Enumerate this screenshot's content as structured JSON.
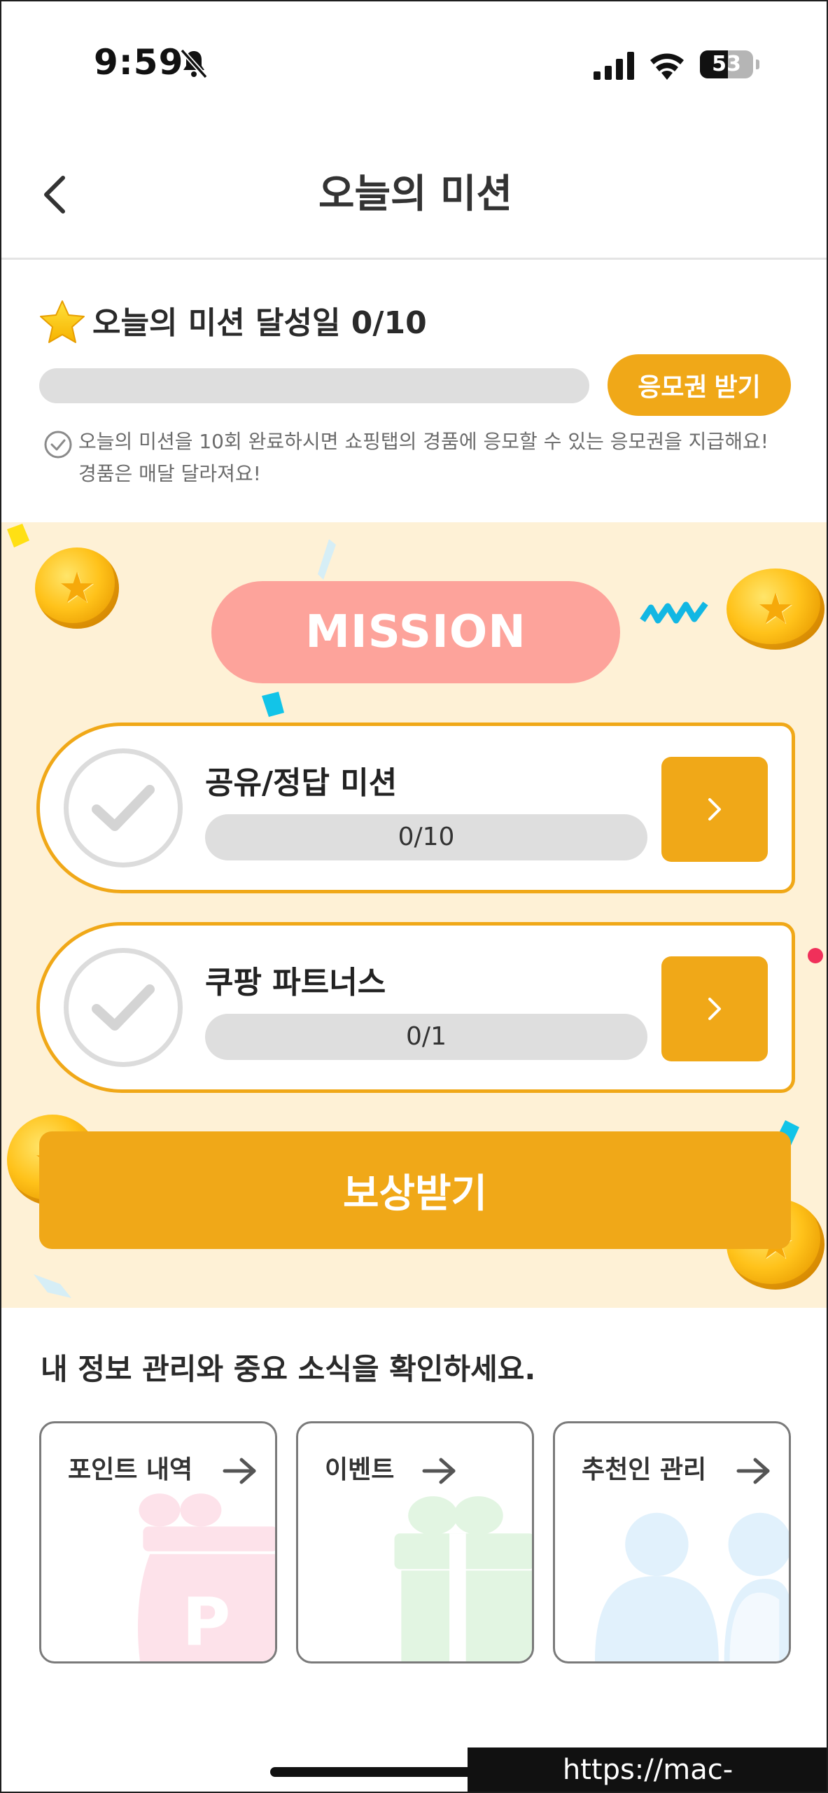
{
  "status_bar": {
    "time": "9:59",
    "battery": "53",
    "battery_level": 0.53
  },
  "header": {
    "title": "오늘의 미션"
  },
  "summary": {
    "title": "오늘의 미션 달성일 0/10",
    "progress": 0,
    "ticket_button": "응모권 받기",
    "note": "오늘의 미션을 10회 완료하시면 쇼핑탭의 경품에 응모할 수 있는 응모권을 지급해요! 경품은 매달 달라져요!"
  },
  "mission": {
    "badge": "MISSION",
    "items": [
      {
        "name": "공유/정답 미션",
        "count": "0/10",
        "progress": 0
      },
      {
        "name": "쿠팡 파트너스",
        "count": "0/1",
        "progress": 0
      }
    ],
    "reward_button": "보상받기"
  },
  "info": {
    "heading": "내 정보 관리와 중요 소식을 확인하세요.",
    "cards": [
      {
        "label": "포인트 내역",
        "icon": "point-pouch-icon"
      },
      {
        "label": "이벤트",
        "icon": "gift-icon"
      },
      {
        "label": "추천인 관리",
        "icon": "people-icon"
      }
    ]
  },
  "watermark": "https://mac-os.tistory.com",
  "colors": {
    "accent": "#f0a818",
    "mission_badge": "#fda39b",
    "mission_bg": "#fef1d6"
  }
}
